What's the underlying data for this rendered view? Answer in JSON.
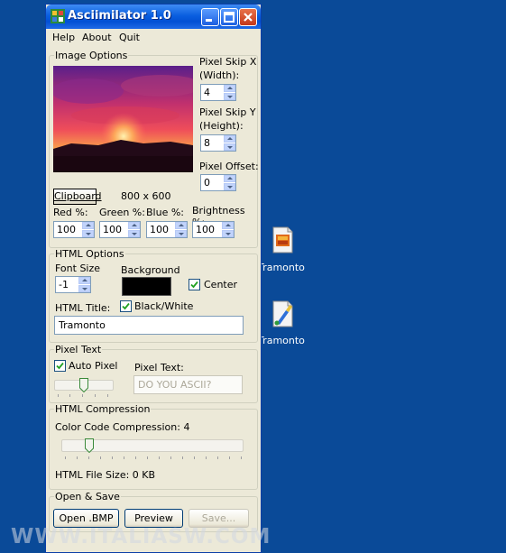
{
  "window": {
    "title": "Asciimilator 1.0"
  },
  "menu": {
    "items": [
      "Help",
      "About",
      "Quit"
    ]
  },
  "image_options": {
    "legend": "Image Options",
    "skip_x_label_1": "Pixel Skip X",
    "skip_x_label_2": "(Width):",
    "skip_x_value": "4",
    "skip_y_label_1": "Pixel Skip Y",
    "skip_y_label_2": "(Height):",
    "skip_y_value": "8",
    "offset_label": "Pixel Offset:",
    "offset_value": "0",
    "clipboard_label": "Clipboard",
    "dimensions": "800 x 600",
    "red_label": "Red %:",
    "red_value": "100",
    "green_label": "Green %:",
    "green_value": "100",
    "blue_label": "Blue %:",
    "blue_value": "100",
    "brightness_label": "Brightness %:",
    "brightness_value": "100"
  },
  "html_options": {
    "legend": "HTML Options",
    "font_size_label": "Font Size",
    "font_size_value": "-1",
    "background_label": "Background",
    "background_color": "#000000",
    "center_label": "Center",
    "center_checked": true,
    "bw_label": "Black/White",
    "bw_checked": true,
    "title_label": "HTML Title:",
    "title_value": "Tramonto"
  },
  "pixel_text": {
    "legend": "Pixel Text",
    "auto_label": "Auto Pixel",
    "auto_checked": true,
    "text_label": "Pixel Text:",
    "text_value": "DO YOU ASCII?"
  },
  "compression": {
    "legend": "HTML Compression",
    "label": "Color Code Compression: 4",
    "value": 4,
    "file_size": "HTML File Size:  0 KB"
  },
  "open_save": {
    "legend": "Open & Save",
    "open_label": "Open .BMP",
    "preview_label": "Preview",
    "save_label": "Save..."
  },
  "desktop": {
    "icon1_label": "Tramonto",
    "icon2_label": "Tramonto"
  },
  "watermark": "WWW.ITALIASW.COM"
}
